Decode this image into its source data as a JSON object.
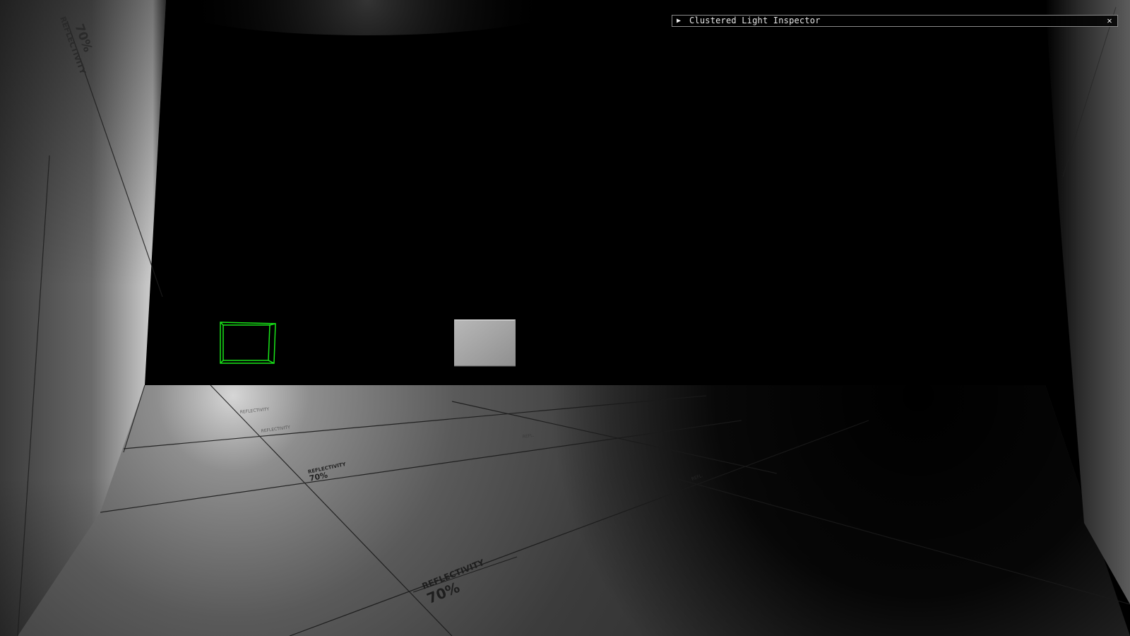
{
  "window": {
    "panel_title": "Clustered Light Inspector",
    "collapse_icon": "triangle-right-icon",
    "close_icon": "close-icon"
  },
  "scene": {
    "floor_labels": [
      {
        "title": "REFLECTIVITY",
        "value": "70%"
      },
      {
        "title": "REFLECTIVITY",
        "value": "70%"
      }
    ],
    "wall_labels": [
      {
        "title": "REFLECTIVITY",
        "value": "70%"
      }
    ],
    "colors": {
      "light_gizmo": "#19e619",
      "background": "#000000",
      "panel_border": "#8a8a8a",
      "panel_text": "#e8e8e8"
    }
  }
}
